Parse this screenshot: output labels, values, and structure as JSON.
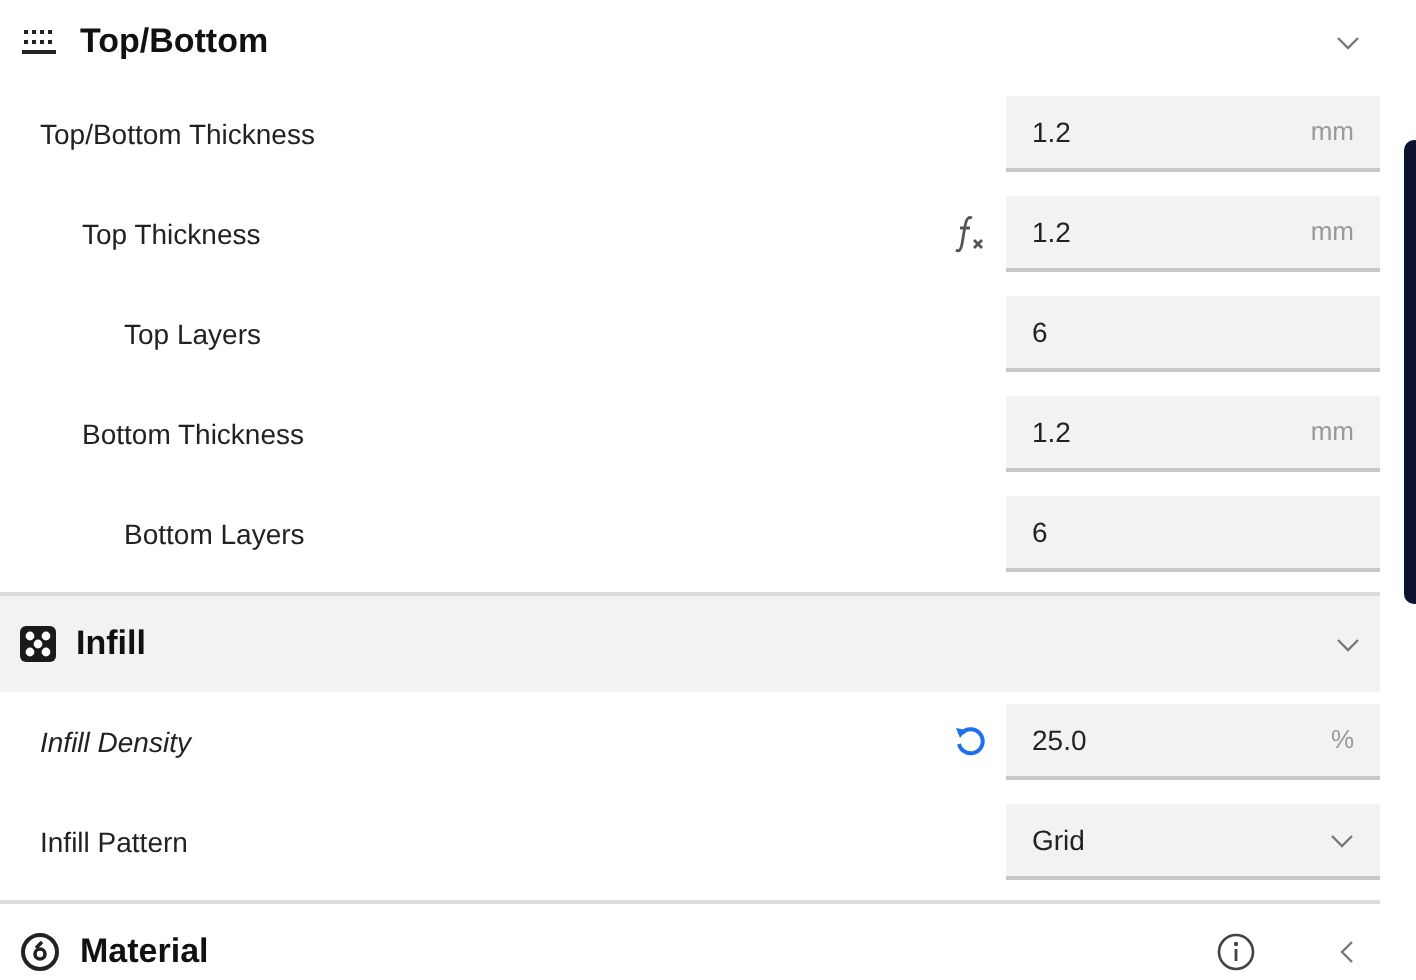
{
  "sections": [
    {
      "title": "Top/Bottom",
      "expanded": true,
      "highlighted": false,
      "info": false,
      "settings": [
        {
          "label": "Top/Bottom Thickness",
          "kind": "number",
          "value": "1.2",
          "unit": "mm",
          "modified": false,
          "children": [
            {
              "label": "Top Thickness",
              "kind": "number",
              "value": "1.2",
              "unit": "mm",
              "modified": false,
              "formula": true,
              "children": [
                {
                  "label": "Top Layers",
                  "kind": "number",
                  "value": "6",
                  "modified": false
                }
              ]
            },
            {
              "label": "Bottom Thickness",
              "kind": "number",
              "value": "1.2",
              "unit": "mm",
              "modified": false,
              "children": [
                {
                  "label": "Bottom Layers",
                  "kind": "number",
                  "value": "6",
                  "modified": false
                }
              ]
            }
          ]
        }
      ]
    },
    {
      "title": "Infill",
      "expanded": true,
      "highlighted": true,
      "info": false,
      "settings": [
        {
          "label": "Infill Density",
          "kind": "number",
          "value": "25.0",
          "unit": "%",
          "modified": true
        },
        {
          "label": "Infill Pattern",
          "kind": "dropdown",
          "value": "Grid",
          "modified": false
        }
      ]
    },
    {
      "title": "Material",
      "expanded": false,
      "highlighted": false,
      "info": true
    }
  ]
}
